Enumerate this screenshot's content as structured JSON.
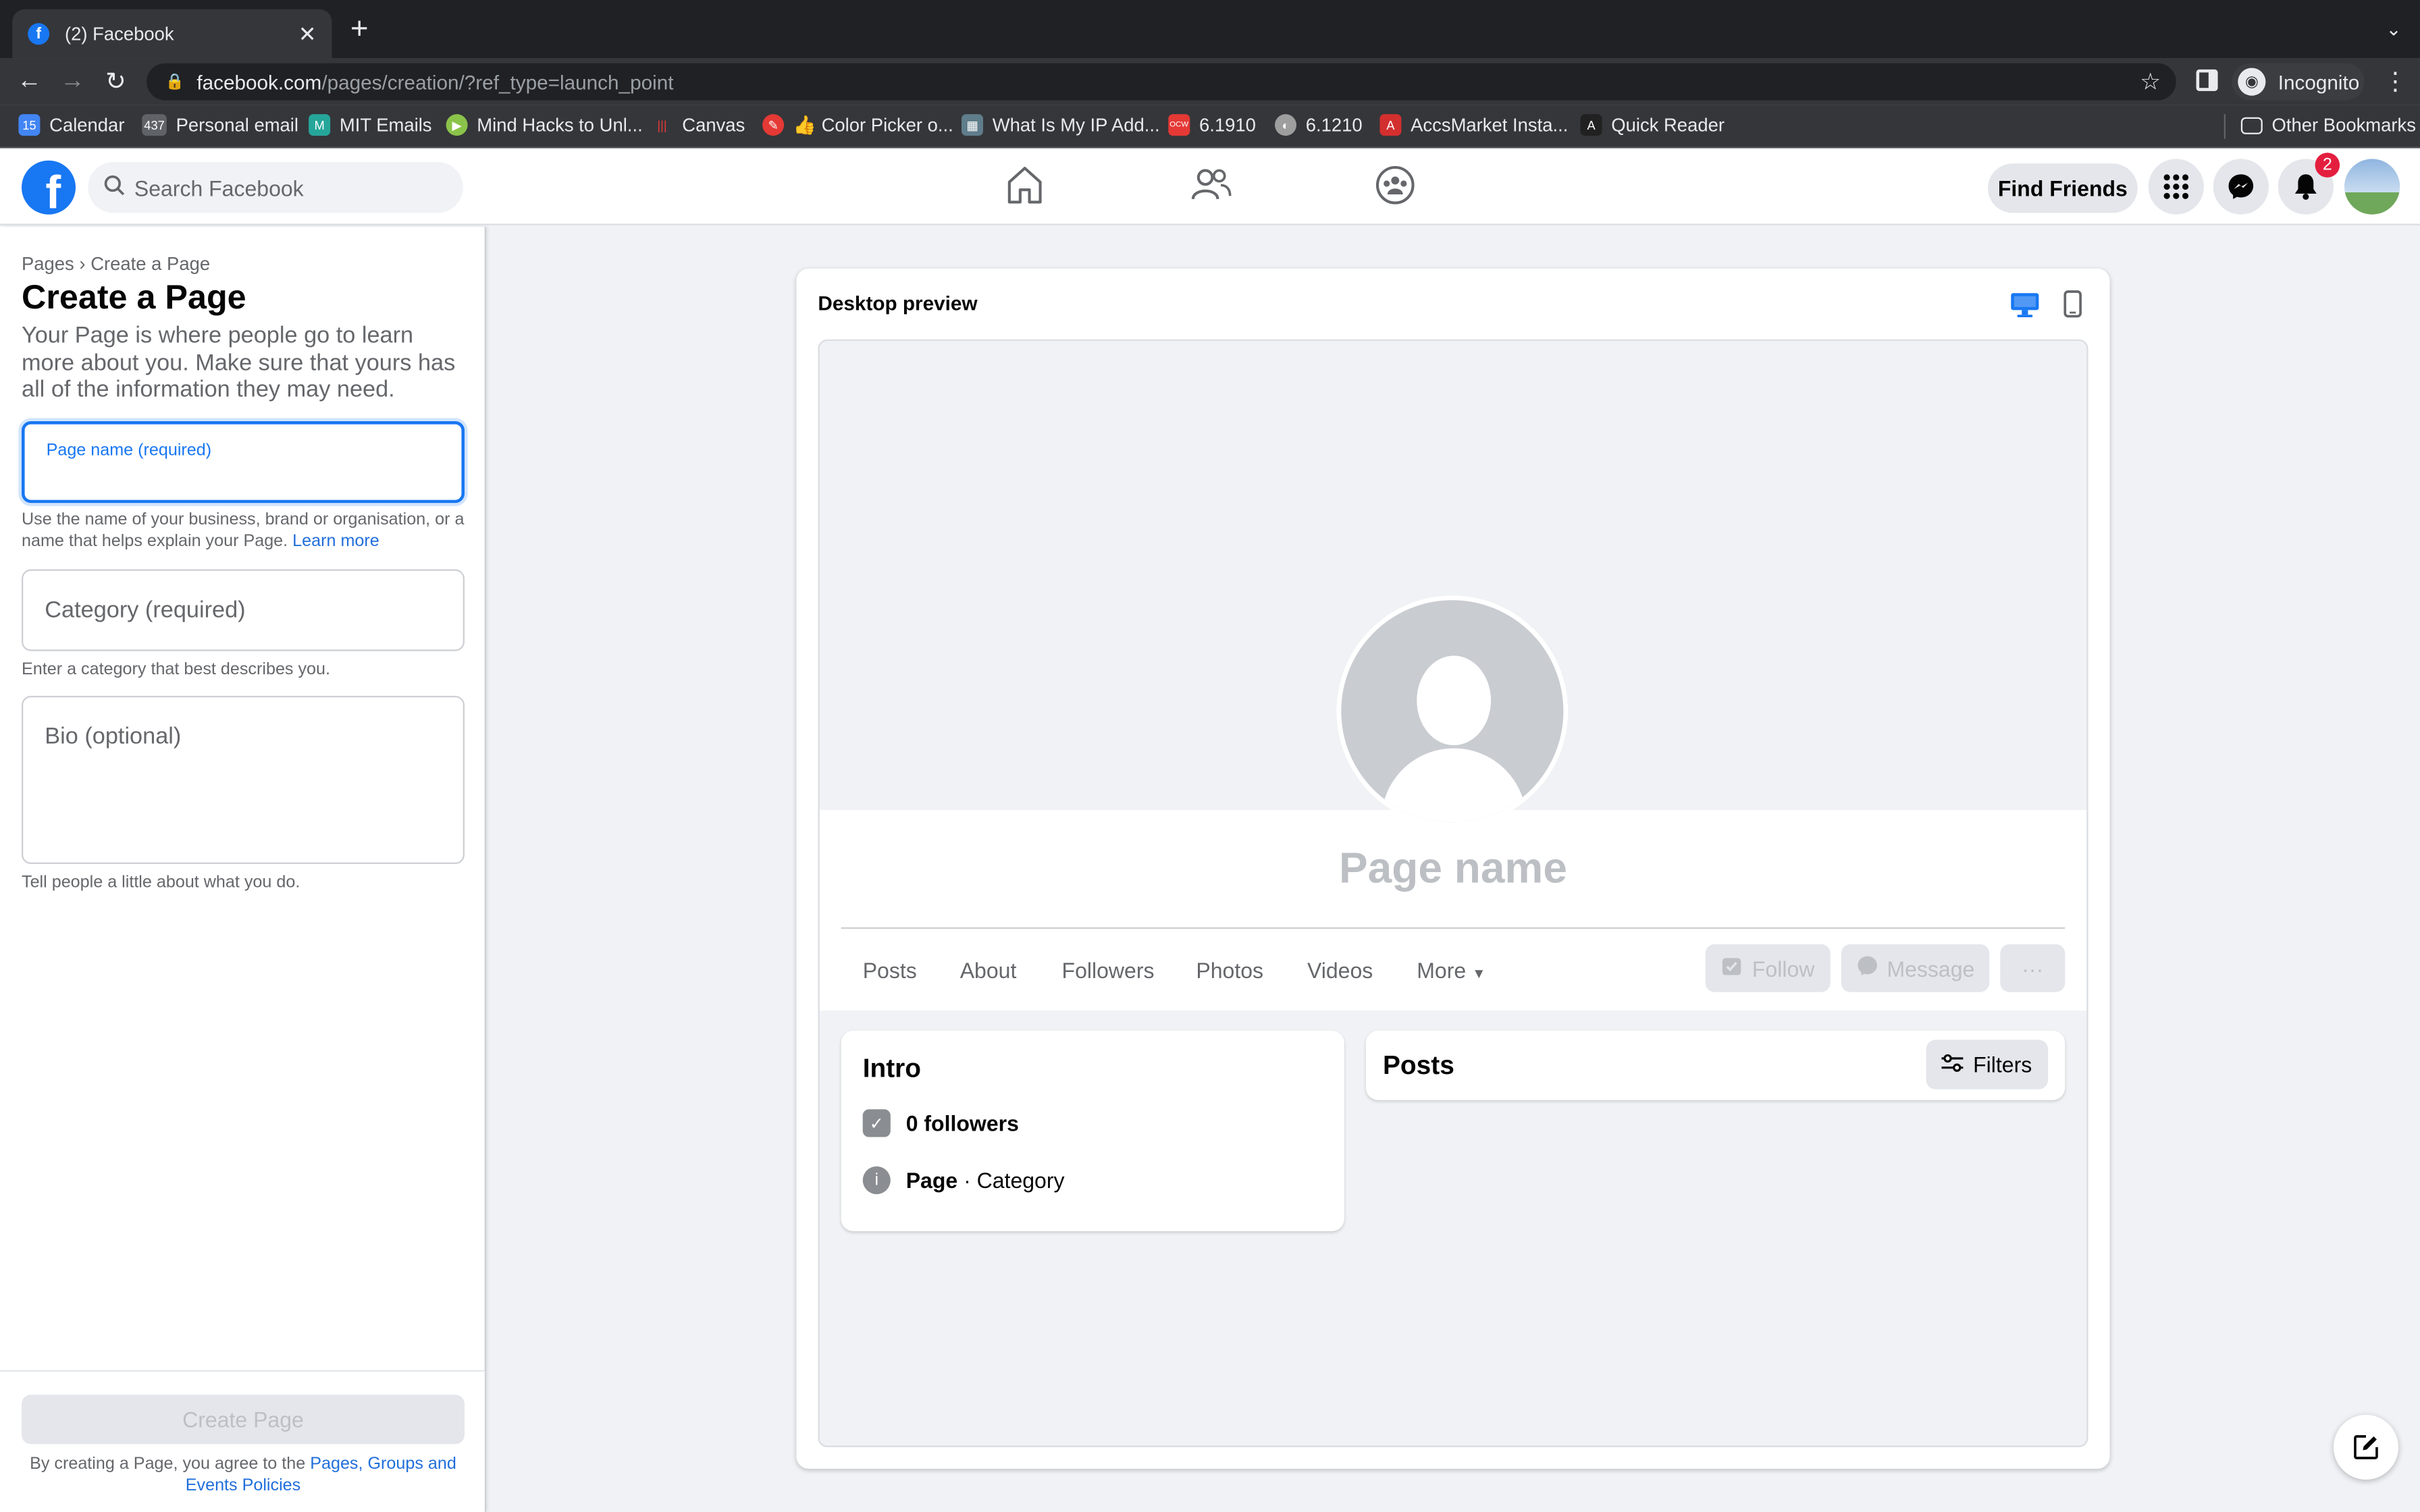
{
  "browser": {
    "tab_title": "(2) Facebook",
    "tab_favicon": "f",
    "url_host": "facebook.com",
    "url_path": "/pages/creation/?ref_type=launch_point",
    "profile_label": "Incognito",
    "bookmarks": [
      {
        "label": "Calendar",
        "color": "#4285f4",
        "icon": "15"
      },
      {
        "label": "Personal email",
        "color": "#5f6368",
        "icon": "437"
      },
      {
        "label": "MIT Emails",
        "color": "#26a69a",
        "icon": "M"
      },
      {
        "label": "Mind Hacks to Unl...",
        "color": "#8bc34a",
        "icon": "▶"
      },
      {
        "label": "Canvas",
        "color": "#e53935",
        "icon": "|||"
      },
      {
        "label": "👍 Color Picker o...",
        "color": "#e53935",
        "icon": "✎"
      },
      {
        "label": "What Is My IP Add...",
        "color": "#607d8b",
        "icon": "▦"
      },
      {
        "label": "6.1910",
        "color": "#e53935",
        "icon": "OCW"
      },
      {
        "label": "6.1210",
        "color": "#9e9e9e",
        "icon": "◐"
      },
      {
        "label": "AccsMarket Insta...",
        "color": "#d32f2f",
        "icon": "A"
      },
      {
        "label": "Quick Reader",
        "color": "#212121",
        "icon": "A"
      }
    ],
    "other_bookmarks": "Other Bookmarks"
  },
  "fb": {
    "logo": "f",
    "search_placeholder": "Search Facebook",
    "find_friends": "Find Friends",
    "notification_count": "2"
  },
  "form": {
    "breadcrumb_root": "Pages",
    "breadcrumb_sep": "›",
    "breadcrumb_current": "Create a Page",
    "title": "Create a Page",
    "description": "Your Page is where people go to learn more about you. Make sure that yours has all of the information they may need.",
    "page_name_label": "Page name (required)",
    "page_name_value": "",
    "page_name_help": "Use the name of your business, brand or organisation, or a name that helps explain your Page.",
    "learn_more": "Learn more",
    "category_placeholder": "Category (required)",
    "category_help": "Enter a category that best describes you.",
    "bio_placeholder": "Bio (optional)",
    "bio_help": "Tell people a little about what you do.",
    "create_button": "Create Page",
    "terms_prefix": "By creating a Page, you agree to the",
    "terms_link": "Pages, Groups and Events Policies"
  },
  "preview": {
    "title": "Desktop preview",
    "page_name": "Page name",
    "tabs": [
      "Posts",
      "About",
      "Followers",
      "Photos",
      "Videos",
      "More"
    ],
    "follow": "Follow",
    "message": "Message",
    "more_actions": "···",
    "intro_title": "Intro",
    "followers": "0 followers",
    "page_label": "Page",
    "category_label": "· Category",
    "posts_title": "Posts",
    "filters": "Filters"
  }
}
